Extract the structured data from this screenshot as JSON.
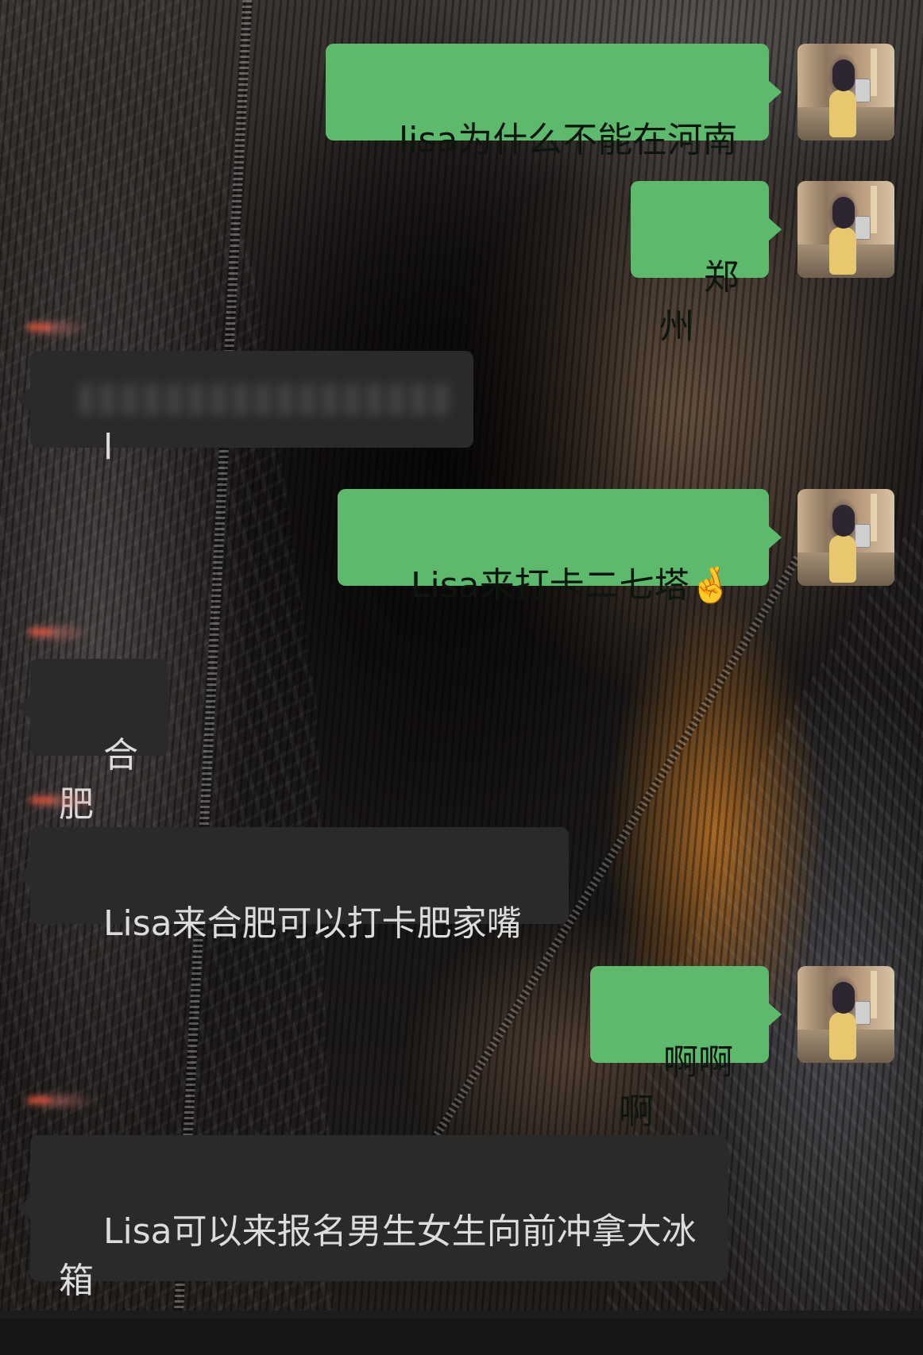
{
  "chat": {
    "messages": [
      {
        "side": "out",
        "text": "lisa为什么不能在河南"
      },
      {
        "side": "out",
        "text": "郑州"
      },
      {
        "side": "in",
        "text": "l",
        "redacted": true
      },
      {
        "side": "out",
        "text": "Lisa来打卡二七塔🤞"
      },
      {
        "side": "in",
        "text": "合肥"
      },
      {
        "side": "in",
        "text": "Lisa来合肥可以打卡肥家嘴"
      },
      {
        "side": "out",
        "text": "啊啊啊"
      },
      {
        "side": "in",
        "text": "Lisa可以来报名男生女生向前冲拿大冰箱"
      }
    ]
  },
  "colors": {
    "outgoing_bubble": "#5dba6d",
    "incoming_bubble": "#2a2a2a",
    "incoming_text": "#dcdcdc"
  },
  "icons": {
    "avatar": "self-avatar-photo",
    "sender_name": "redacted-name"
  }
}
